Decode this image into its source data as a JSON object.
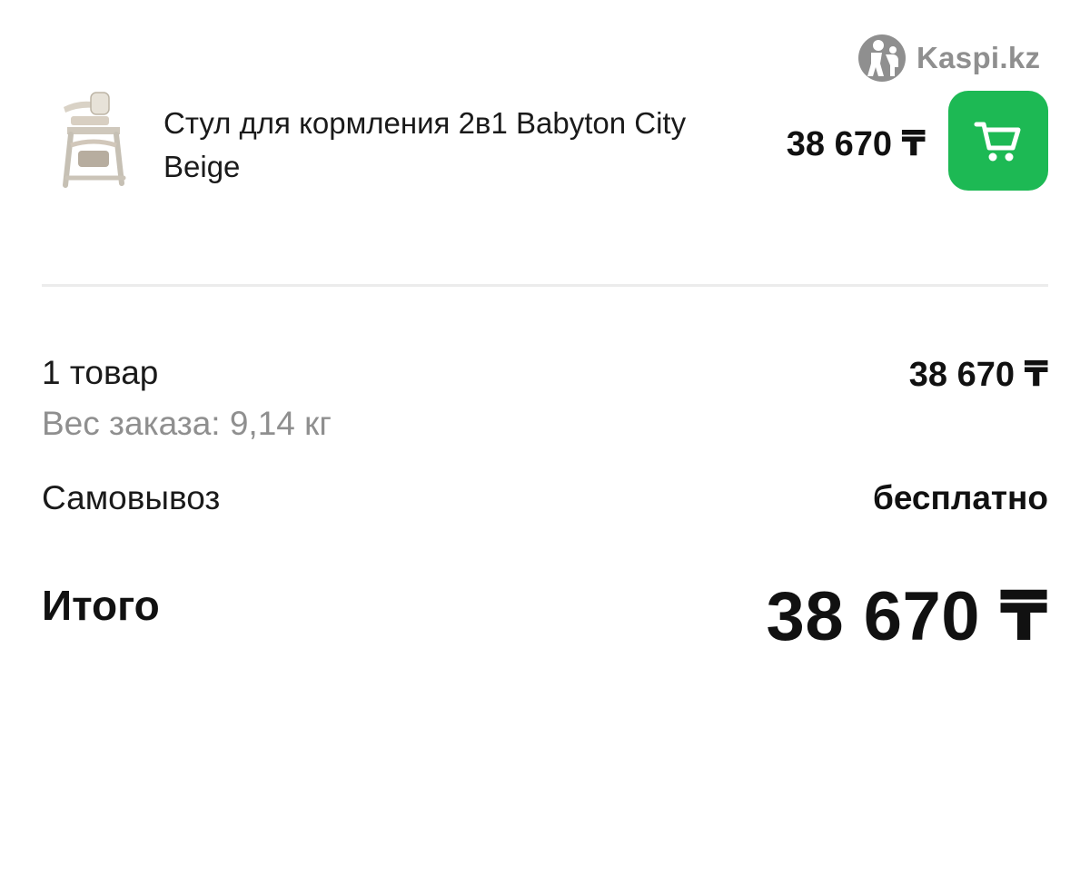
{
  "brand": {
    "name": "Kaspi.kz",
    "icon": "kaspi-logo-icon",
    "color": "#8f8f8f"
  },
  "product": {
    "name": "Стул для кормления 2в1 Babyton City Beige",
    "price": "38 670 ₸",
    "thumbnail_icon": "high-chair-image",
    "cart_icon": "cart-icon",
    "cart_color": "#1db954"
  },
  "summary": {
    "items_label": "1 товар",
    "items_value": "38 670 ₸",
    "weight": "Вес заказа: 9,14 кг",
    "delivery_label": "Самовывоз",
    "delivery_value": "бесплатно",
    "total_label": "Итого",
    "total_value": "38 670 ₸"
  }
}
